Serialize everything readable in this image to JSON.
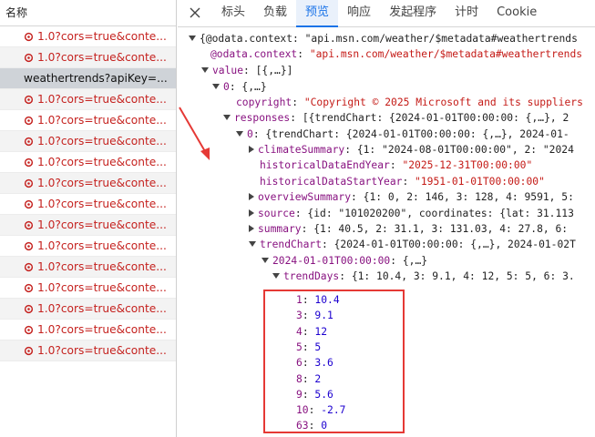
{
  "list": {
    "header": "名称",
    "rows": [
      {
        "text": "1.0?cors=true&conte...",
        "type": "cors"
      },
      {
        "text": "1.0?cors=true&conte...",
        "type": "cors"
      },
      {
        "text": "weathertrends?apiKey=...",
        "type": "selected"
      },
      {
        "text": "1.0?cors=true&conte...",
        "type": "cors"
      },
      {
        "text": "1.0?cors=true&conte...",
        "type": "cors"
      },
      {
        "text": "1.0?cors=true&conte...",
        "type": "cors"
      },
      {
        "text": "1.0?cors=true&conte...",
        "type": "cors"
      },
      {
        "text": "1.0?cors=true&conte...",
        "type": "cors"
      },
      {
        "text": "1.0?cors=true&conte...",
        "type": "cors"
      },
      {
        "text": "1.0?cors=true&conte...",
        "type": "cors"
      },
      {
        "text": "1.0?cors=true&conte...",
        "type": "cors"
      },
      {
        "text": "1.0?cors=true&conte...",
        "type": "cors"
      },
      {
        "text": "1.0?cors=true&conte...",
        "type": "cors"
      },
      {
        "text": "1.0?cors=true&conte...",
        "type": "cors"
      },
      {
        "text": "1.0?cors=true&conte...",
        "type": "cors"
      },
      {
        "text": "1.0?cors=true&conte...",
        "type": "cors"
      }
    ]
  },
  "tabs": [
    {
      "label": "标头",
      "active": false
    },
    {
      "label": "负载",
      "active": false
    },
    {
      "label": "预览",
      "active": true
    },
    {
      "label": "响应",
      "active": false
    },
    {
      "label": "发起程序",
      "active": false
    },
    {
      "label": "计时",
      "active": false
    },
    {
      "label": "Cookie",
      "active": false
    }
  ],
  "preview": {
    "root_line": "{@odata.context: \"api.msn.com/weather/$metadata#weathertrends",
    "odata_key": "@odata.context",
    "odata_val": "\"api.msn.com/weather/$metadata#weathertrends",
    "value_key": "value",
    "value_summary": "[{,…}]",
    "item0_key": "0",
    "item0_summary": "{,…}",
    "copyright_key": "copyright",
    "copyright_val": "\"Copyright © 2025 Microsoft and its suppliers",
    "responses_key": "responses",
    "responses_summary": "[{trendChart: {2024-01-01T00:00:00: {,…}, 2",
    "resp0_key": "0",
    "resp0_summary": "{trendChart: {2024-01-01T00:00:00: {,…}, 2024-01-",
    "climate_key": "climateSummary",
    "climate_summary": "{1: \"2024-08-01T00:00:00\", 2: \"2024",
    "hist_end_key": "historicalDataEndYear",
    "hist_end_val": "\"2025-12-31T00:00:00\"",
    "hist_start_key": "historicalDataStartYear",
    "hist_start_val": "\"1951-01-01T00:00:00\"",
    "overview_key": "overviewSummary",
    "overview_summary": "{1: 0, 2: 146, 3: 128, 4: 9591, 5:",
    "source_key": "source",
    "source_summary": "{id: \"101020200\", coordinates: {lat: 31.113",
    "summary_key": "summary",
    "summary_summary": "{1: 40.5, 2: 31.1, 3: 131.03, 4: 27.8, 6:",
    "trendchart_key": "trendChart",
    "trendchart_summary": "{2024-01-01T00:00:00: {,…}, 2024-01-02T",
    "date_key": "2024-01-01T00:00:00",
    "date_summary": "{,…}",
    "trenddays_key": "trendDays",
    "trenddays_summary": "{1: 10.4, 3: 9.1, 4: 12, 5: 5, 6: 3.",
    "trend_days": [
      {
        "key": "1",
        "value": "10.4"
      },
      {
        "key": "3",
        "value": "9.1"
      },
      {
        "key": "4",
        "value": "12"
      },
      {
        "key": "5",
        "value": "5"
      },
      {
        "key": "6",
        "value": "3.6"
      },
      {
        "key": "8",
        "value": "2"
      },
      {
        "key": "9",
        "value": "5.6"
      },
      {
        "key": "10",
        "value": "-2.7"
      },
      {
        "key": "63",
        "value": "0"
      }
    ]
  },
  "colors": {
    "accent": "#1a73e8",
    "error_text": "#c5221f",
    "highlight": "#e53935",
    "json_key": "#881280",
    "json_string": "#c41a16",
    "json_number": "#1c00cf"
  },
  "icons": {
    "close": "close-icon",
    "cors": "gear-warning-icon",
    "expand": "triangle-icon"
  }
}
